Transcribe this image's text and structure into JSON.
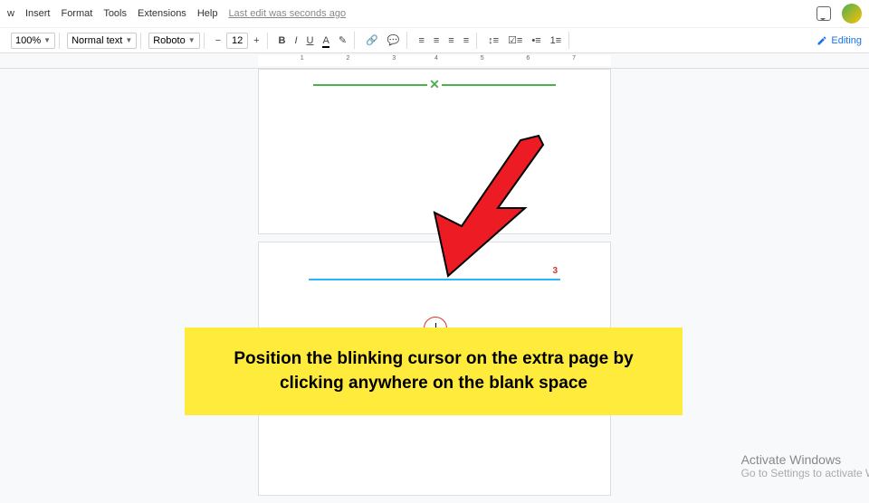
{
  "menubar": {
    "items": [
      "w",
      "Insert",
      "Format",
      "Tools",
      "Extensions",
      "Help"
    ],
    "status": "Last edit was seconds ago"
  },
  "toolbar": {
    "zoom": "100%",
    "style": "Normal text",
    "font": "Roboto",
    "size": "12",
    "editing": "Editing"
  },
  "ruler": {
    "marks": [
      "1",
      "2",
      "3",
      "4",
      "5",
      "6",
      "7"
    ]
  },
  "page2": {
    "number": "3"
  },
  "instruction": "Position the blinking cursor on the extra page by clicking anywhere on the blank space",
  "watermark": {
    "title": "Activate Windows",
    "sub": "Go to Settings to activate Wi"
  }
}
